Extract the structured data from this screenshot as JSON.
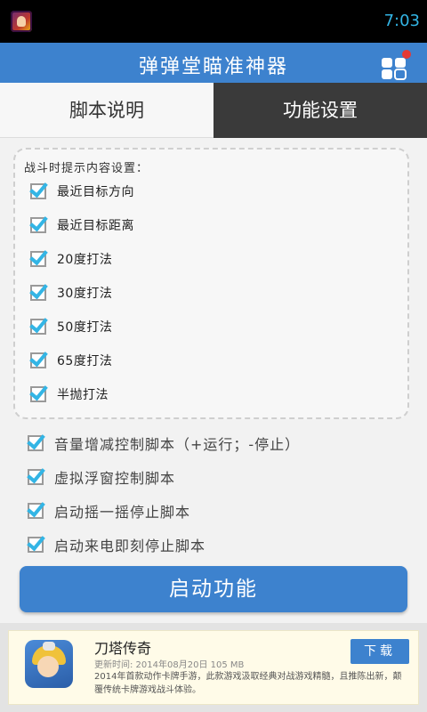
{
  "status_bar": {
    "time": "7:03"
  },
  "app": {
    "title": "弹弹堂瞄准神器"
  },
  "tabs": [
    {
      "label": "脚本说明",
      "selected": false
    },
    {
      "label": "功能设置",
      "selected": true
    }
  ],
  "battle_tips": {
    "title": "战斗时提示内容设置：",
    "options": [
      {
        "label": "最近目标方向",
        "checked": true
      },
      {
        "label": "最近目标距离",
        "checked": true
      },
      {
        "label": "20度打法",
        "checked": true
      },
      {
        "label": "30度打法",
        "checked": true
      },
      {
        "label": "50度打法",
        "checked": true
      },
      {
        "label": "65度打法",
        "checked": true
      },
      {
        "label": "半抛打法",
        "checked": true
      }
    ]
  },
  "script_controls": [
    {
      "label": "音量增减控制脚本（+运行；-停止）",
      "checked": true
    },
    {
      "label": "虚拟浮窗控制脚本",
      "checked": true
    },
    {
      "label": "启动摇一摇停止脚本",
      "checked": true
    },
    {
      "label": "启动来电即刻停止脚本",
      "checked": true
    }
  ],
  "start_button": {
    "label": "启动功能"
  },
  "ad": {
    "title": "刀塔传奇",
    "meta": "更新时间: 2014年08月20日 105 MB",
    "description": "2014年首款动作卡牌手游，此款游戏汲取经典对战游戏精髓，且推陈出新，颠覆传统卡牌游戏战斗体验。",
    "download_label": "下载"
  },
  "colors": {
    "accent": "#3d82ce",
    "check": "#33b5e5",
    "tab_selected_bg": "#3a3a3a"
  }
}
